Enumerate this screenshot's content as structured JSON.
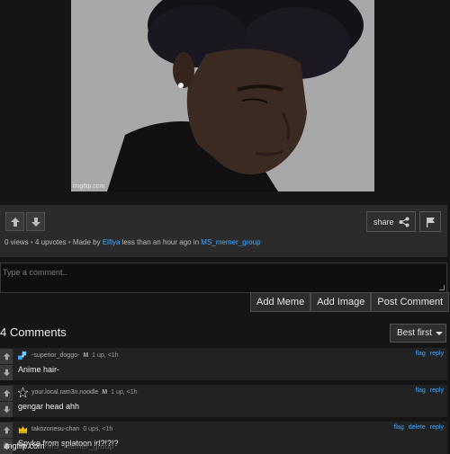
{
  "meme": {
    "watermark": "imgflip.com"
  },
  "post_bar": {
    "share_label": "share",
    "meta": {
      "views": "0 views",
      "upvotes": "4 upvotes",
      "made_by_prefix": "Made by",
      "author": "Elflya",
      "time": "less than an hour ago in",
      "stream": "MS_memer_group"
    }
  },
  "comment_form": {
    "placeholder": "Type a comment..",
    "buttons": [
      "Add Meme",
      "Add Image",
      "Post Comment"
    ]
  },
  "comments_header": {
    "title": "4 Comments",
    "sort_label": "Best first"
  },
  "comments": [
    {
      "user": "-superior_doggo-",
      "mod_badge": "M",
      "stats": "1 up, <1h",
      "text": "Anime hair-",
      "links": [
        "flag",
        "reply"
      ]
    },
    {
      "user": "your.local.ram3n.noodle",
      "mod_badge": "M",
      "stats": "1 up, <1h",
      "text": "gengar head ahh",
      "links": [
        "flag",
        "reply"
      ]
    },
    {
      "user": "takozonesu-chan",
      "mod_badge": "",
      "stats": "0 ups, <1h",
      "text": "Spyke from splatoon irl?!?!?",
      "links": [
        "flag",
        "delete",
        "reply"
      ]
    }
  ],
  "footer": {
    "watermark": "imgflip.com",
    "faint_text": "/MS_memer_group"
  },
  "colors": {
    "link": "#3fa7ff",
    "background": "#151515",
    "panel": "#2b2b2b"
  }
}
